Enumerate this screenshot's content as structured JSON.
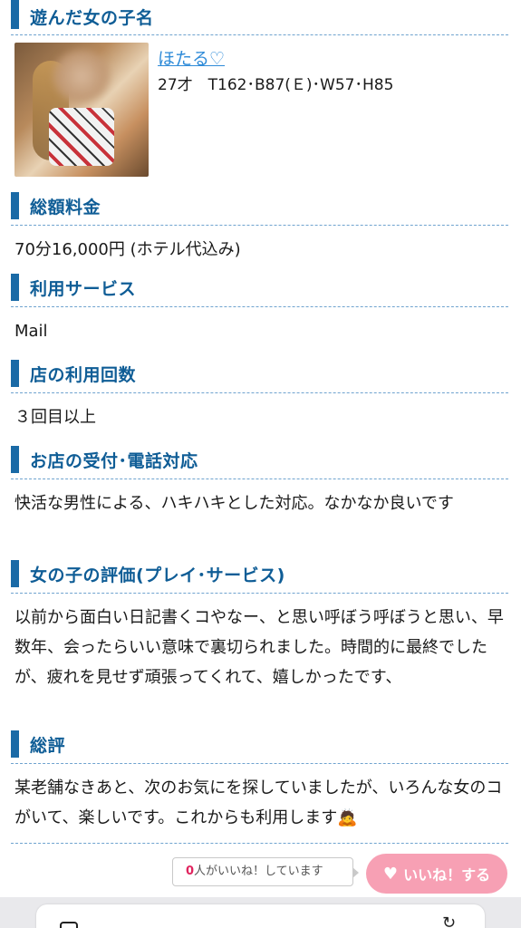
{
  "sections": {
    "girl": {
      "title": "遊んだ女の子名",
      "name": "ほたる♡",
      "stats": "27才　T162･B87(Ｅ)･W57･H85"
    },
    "price": {
      "title": "総額料金",
      "body": "70分16,000円 (ホテル代込み)"
    },
    "service": {
      "title": "利用サービス",
      "body": "Mail"
    },
    "visits": {
      "title": "店の利用回数",
      "body": "３回目以上"
    },
    "reception": {
      "title": "お店の受付･電話対応",
      "body": "快活な男性による、ハキハキとした対応。なかなか良いです"
    },
    "evaluation": {
      "title": "女の子の評価(プレイ･サービス)",
      "body": "以前から面白い日記書くコやなー、と思い呼ぼう呼ぼうと思い、早数年、会ったらいい意味で裏切られました。時間的に最終でしたが、疲れを見せず頑張ってくれて、嬉しかったです、"
    },
    "summary": {
      "title": "総評",
      "body": "某老舗なきあと、次のお気にを探していましたが、いろんな女のコがいて、楽しいです。これからも利用します",
      "emoji": "🙇"
    }
  },
  "like": {
    "count": "0",
    "count_text": "人がいいね！しています",
    "button_label": "いいね！する",
    "button_color": "#f7a0b4"
  },
  "browser": {
    "url": "　　　　　　　"
  },
  "colors": {
    "accent": "#1a6aa6",
    "title": "#0f5d96",
    "link": "#2f8bd8"
  }
}
